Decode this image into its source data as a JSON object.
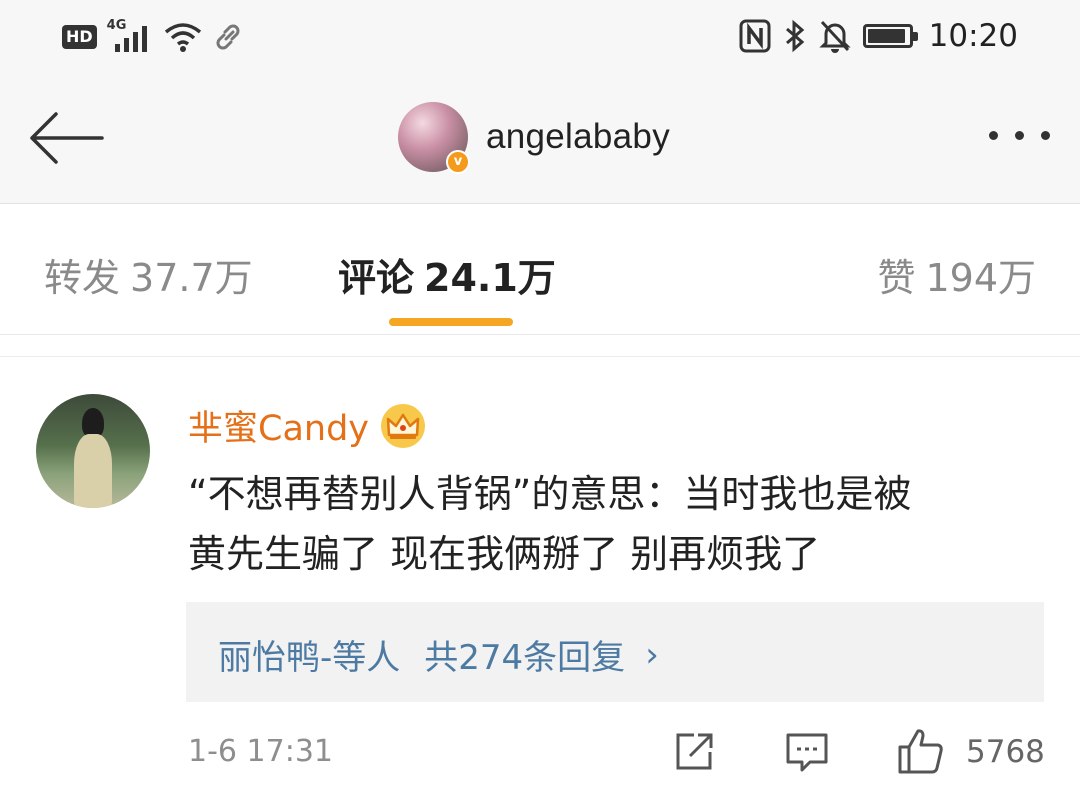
{
  "status_bar": {
    "hd": "HD",
    "network": "4G",
    "time": "10:20"
  },
  "header": {
    "username": "angelababy"
  },
  "tabs": [
    {
      "label": "转发",
      "count": "37.7万",
      "active": false
    },
    {
      "label": "评论",
      "count": "24.1万",
      "active": true
    },
    {
      "label": "赞",
      "count": "194万",
      "active": false
    }
  ],
  "comment": {
    "author": "芈蜜Candy",
    "text_line1": "“不想再替别人背锅”的意思：当时我也是被",
    "text_line2": "黄先生骗了 现在我俩掰了 别再烦我了",
    "replies": {
      "users": "丽怡鸭-等人",
      "count_text": "共274条回复",
      "arrow": "›"
    },
    "time": "1-6 17:31",
    "likes": "5768"
  },
  "colors": {
    "accent": "#f5a623",
    "author": "#e5701a",
    "link": "#4d7aa3"
  },
  "icons": [
    "back-arrow-icon",
    "more-icon",
    "verified-badge-icon",
    "crown-icon",
    "repost-icon",
    "reply-icon",
    "like-icon",
    "nfc-icon",
    "bluetooth-icon",
    "mute-icon",
    "battery-icon",
    "wifi-icon",
    "signal-icon",
    "link-icon"
  ]
}
